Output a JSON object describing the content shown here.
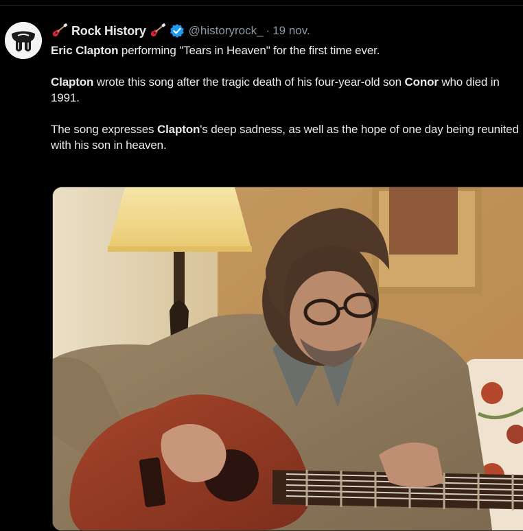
{
  "tweet": {
    "display_name": "Rock History",
    "handle": "@historyrock_",
    "separator": "·",
    "timestamp": "19 nov.",
    "verified": true,
    "paragraphs": [
      [
        {
          "text": "Eric Clapton",
          "bold": true
        },
        {
          "text": " performing \"Tears in Heaven\" for the first time ever.",
          "bold": false
        }
      ],
      [
        {
          "text": "Clapton",
          "bold": true
        },
        {
          "text": " wrote this song after the tragic death of his four-year-old son ",
          "bold": false
        },
        {
          "text": "Conor",
          "bold": true
        },
        {
          "text": " who died in 1991.",
          "bold": false
        }
      ],
      [
        {
          "text": "The song expresses ",
          "bold": false
        },
        {
          "text": "Clapton",
          "bold": true
        },
        {
          "text": "'s deep sadness, as well as the hope of one day being reunited with his son in heaven.",
          "bold": false
        }
      ]
    ]
  },
  "icons": {
    "avatar": "rolling-stones-tongue-logo",
    "name_prefix": "electric-guitar-emoji",
    "name_suffix": "electric-guitar-emoji",
    "verified": "verified-badge-icon"
  },
  "colors": {
    "background": "#000000",
    "text": "#e7e9ea",
    "secondary_text": "#8b98a5",
    "verified_blue": "#1d9bf0",
    "divider": "#2f3336"
  },
  "media": {
    "kind": "video-frame",
    "subject": "man-playing-acoustic-guitar"
  }
}
